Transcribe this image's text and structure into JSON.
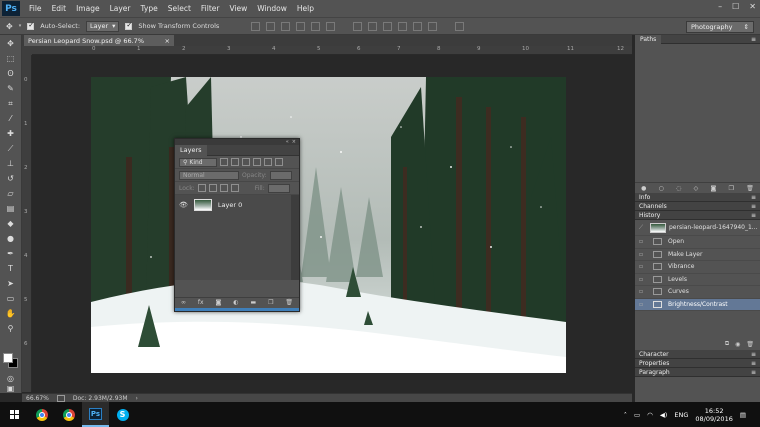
{
  "app": {
    "logo": "Ps",
    "menu": [
      "File",
      "Edit",
      "Image",
      "Layer",
      "Type",
      "Select",
      "Filter",
      "View",
      "Window",
      "Help"
    ],
    "window_controls": [
      "–",
      "☐",
      "✕"
    ]
  },
  "options_bar": {
    "auto_select_label": "Auto-Select:",
    "auto_select_value": "Layer",
    "show_transform_label": "Show Transform Controls",
    "workspace": "Photography"
  },
  "document": {
    "tab_title": "Persian Leopard Snow.psd @ 66.7% (RGB/8#)",
    "tab_close": "×",
    "zoom": "66.67%",
    "doc_size": "Doc: 2.93M/2.93M"
  },
  "ruler": {
    "h_ticks": [
      "0",
      "1",
      "2",
      "3",
      "4",
      "5",
      "6",
      "7",
      "8",
      "9",
      "10",
      "11",
      "12"
    ],
    "v_ticks": [
      "0",
      "1",
      "2",
      "3",
      "4",
      "5",
      "6"
    ]
  },
  "layers_panel": {
    "tab": "Layers",
    "kind_label": "Kind",
    "blend_mode": "Normal",
    "opacity_label": "Opacity:",
    "lock_label": "Lock:",
    "fill_label": "Fill:",
    "layer_name": "Layer 0",
    "footer_icons": [
      "link-icon",
      "fx-icon",
      "mask-icon",
      "adjustment-icon",
      "folder-icon",
      "new-layer-icon",
      "trash-icon"
    ]
  },
  "right_panels": {
    "paths_tab": "Paths",
    "info_tab": "Info",
    "channels_tab": "Channels",
    "history_tab": "History",
    "history_snapshot": "persian-leopard-1647940_1...",
    "history_items": [
      "Open",
      "Make Layer",
      "Vibrance",
      "Levels",
      "Curves",
      "Brightness/Contrast"
    ],
    "history_selected_index": 5,
    "character_tab": "Character",
    "properties_tab": "Properties",
    "paragraph_tab": "Paragraph"
  },
  "taskbar": {
    "language": "ENG",
    "time": "16:52",
    "date": "08/09/2016"
  },
  "colors": {
    "chrome_bg": "#535353",
    "canvas_bg": "#282828",
    "selected_row": "#637896",
    "accent": "#3f7fb9"
  }
}
